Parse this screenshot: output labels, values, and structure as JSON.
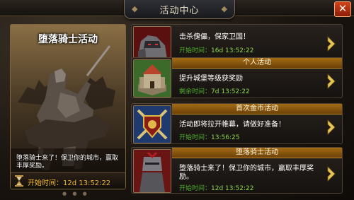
{
  "window": {
    "title": "活动中心",
    "close_label": "✕"
  },
  "featured": {
    "title": "堕落骑士活动",
    "description": "堕落骑士来了！保卫你的城市，赢取丰厚奖励。",
    "time_label": "开始时间：",
    "time_value": "12d 13:52:22"
  },
  "events": [
    {
      "header": "",
      "text": "击杀傀儡，保家卫国！",
      "time_label": "开始时间：",
      "time_value": "16d 13:52:22"
    },
    {
      "header": "个人活动",
      "text": "提升城堡等级获奖励",
      "time_label": "剩余时间：",
      "time_value": "7d 13:52:22"
    },
    {
      "header": "首次金币活动",
      "text": "活动即将拉开帷幕，请做好准备！",
      "time_label": "开始时间：",
      "time_value": "13:56:25"
    },
    {
      "header": "堕落骑士活动",
      "text": "堕落骑士来了！保卫你的城市，赢取丰厚奖励。",
      "time_label": "开始时间：",
      "time_value": "12d 13:52:22"
    }
  ],
  "colors": {
    "accent": "#f2b832",
    "time_green": "#50ad2c",
    "close_red": "#c0391a",
    "header_gold": "#a36b14"
  }
}
